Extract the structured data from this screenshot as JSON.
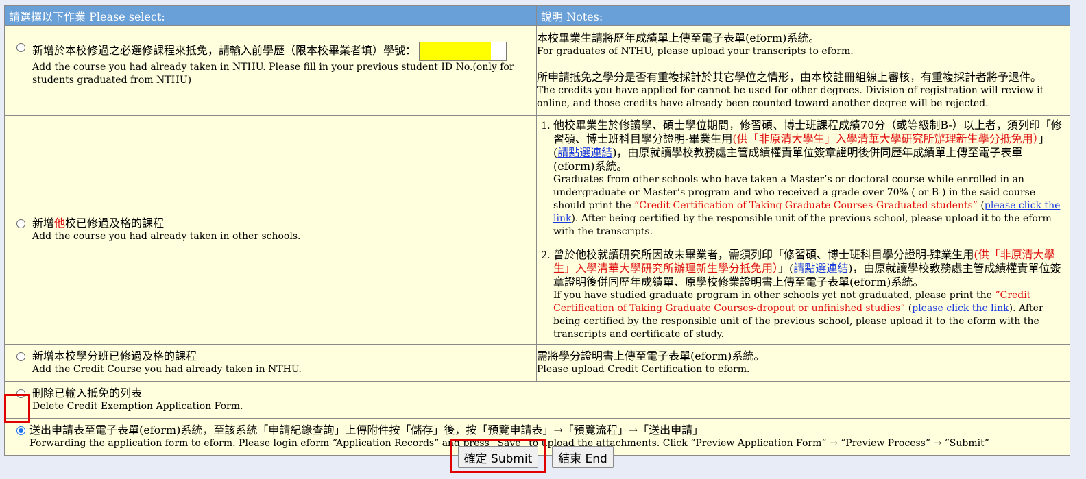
{
  "header": {
    "select_title": "請選擇以下作業 Please select:",
    "notes_title": "說明 Notes:"
  },
  "options": [
    {
      "zh": "新增於本校修過之必選修課程來抵免，請輸入前學歷（限本校畢業者填）學號：",
      "en": "Add the course you had already taken in NTHU. Please fill in your previous student ID No.(only for students graduated from NTHU)",
      "input_value": "",
      "checked": false
    },
    {
      "zh_pre": "新增",
      "zh_red": "他",
      "zh_post": "校已修過及格的課程",
      "en": "Add the course you had already taken in other schools.",
      "checked": false
    },
    {
      "zh": "新增本校學分班已修過及格的課程",
      "en": "Add the Credit Course you had already taken in NTHU.",
      "checked": false
    },
    {
      "zh": "刪除已輸入抵免的列表",
      "en": "Delete Credit Exemption Application Form.",
      "checked": false
    },
    {
      "zh": "送出申請表至電子表單(eform)系統，至該系統「申請紀錄查詢」上傳附件按「儲存」後，按「預覽申請表」→「預覽流程」→「送出申請」",
      "en": "Forwarding the application form to eform. Please login eform “Application Records” and press “Save” to upload the attachments. Click “Preview Application Form” → “Preview Process” → “Submit”",
      "checked": true
    }
  ],
  "notes": {
    "row1": {
      "zh1": "本校畢業生請將歷年成績單上傳至電子表單(eform)系統。",
      "en1": "For graduates of NTHU, please upload your transcripts to eform.",
      "zh2": "所申請抵免之學分是否有重複採計於其它學位之情形，由本校註冊組線上審核，有重複採計者將予退件。",
      "en2": "The credits you have applied for cannot be used for other degrees. Division of registration will review it online, and those credits have already been counted toward another degree will be rejected."
    },
    "row2": {
      "item1": {
        "zh_a": "他校畢業生於修讀學、碩士學位期間，修習碩、博士班課程成績70分（或等級制B-）以上者，須列印「修習碩、博士班科目學分證明-畢業生用",
        "zh_red": "(供「非原清大學生」入學清華大學研究所辦理新生學分抵免用）",
        "zh_b": "」(",
        "zh_link": "請點選連結",
        "zh_c": ")，由原就讀學校教務處主管成績權責單位簽章證明後併同歷年成績單上傳至電子表單(eform)系統。",
        "en_a": "Graduates from other schools who have taken a Master’s or doctoral course while enrolled in an undergraduate or Master’s program and who received a grade over 70% ( or B-) in the said course should print the ",
        "en_red": "“Credit Certification of Taking Graduate Courses-Graduated students”",
        "en_b": " (",
        "en_link": "please click the link",
        "en_c": "). After being certified by the responsible unit of the previous school, please upload it to the eform with the transcripts."
      },
      "item2": {
        "zh_a": "曾於他校就讀研究所因故未畢業者，需須列印「修習碩、博士班科目學分證明-肄業生用",
        "zh_red": "(供「非原清大學生」入學清華大學研究所辦理新生學分抵免用）",
        "zh_b": "」(",
        "zh_link": "請點選連結",
        "zh_c": ")，由原就讀學校教務處主管成績權責單位簽章證明後併同歷年成績單、原學校修業證明書上傳至電子表單(eform)系統。",
        "en_a": "If you have studied graduate program in other schools yet not graduated, please print the ",
        "en_red": "“Credit Certification of Taking Graduate Courses-dropout or unfinished studies”",
        "en_b": " (",
        "en_link": "please click the link",
        "en_c": "). After being certified by the responsible unit of the previous school, please upload it to the eform with the transcripts and certificate of study."
      }
    },
    "row3": {
      "zh": "需將學分證明書上傳至電子表單(eform)系統。",
      "en": "Please upload Credit Certification to eform."
    }
  },
  "buttons": {
    "submit": "確定 Submit",
    "end": "結束 End"
  }
}
